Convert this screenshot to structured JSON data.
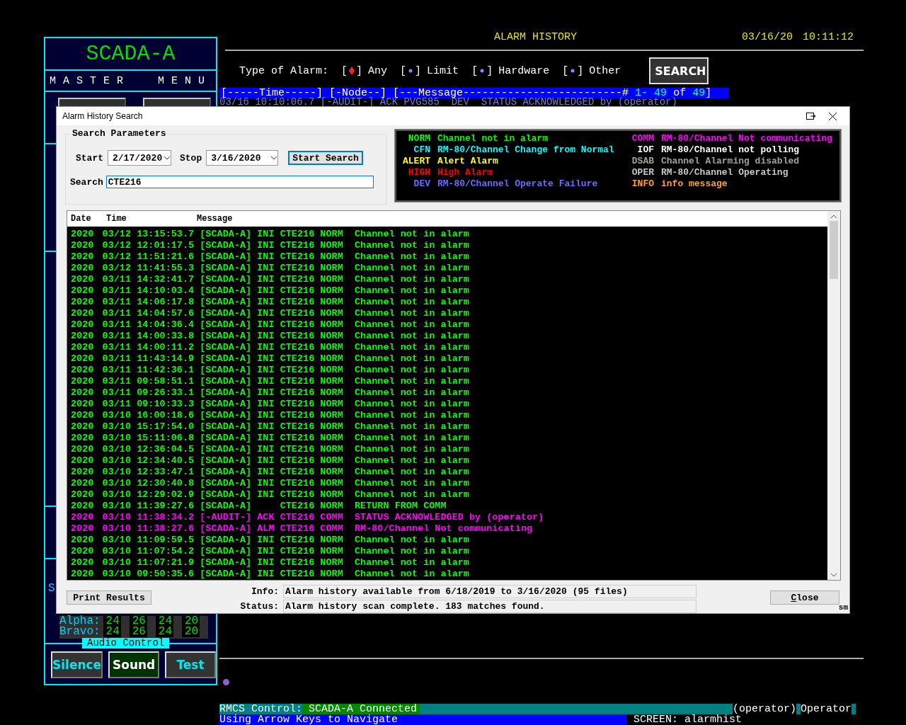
{
  "left_panel": {
    "title": "SCADA-A",
    "subtitle": "MASTER MENU",
    "partial_label": "S",
    "counts": [
      {
        "label": "Alpha:",
        "values": [
          "24",
          "26",
          "24",
          "20"
        ]
      },
      {
        "label": "Bravo:",
        "values": [
          "24",
          "26",
          "24",
          "20"
        ]
      }
    ],
    "audio": {
      "title": "Audio Control",
      "buttons": [
        {
          "label": "Silence",
          "selected": false
        },
        {
          "label": "Sound",
          "selected": true
        },
        {
          "label": "Test",
          "selected": false
        }
      ]
    }
  },
  "header": {
    "title": "ALARM HISTORY",
    "date": "03/16/20",
    "time": "10:11:12"
  },
  "filter": {
    "label": "Type of Alarm:",
    "options": [
      {
        "open": "[",
        "close": "]",
        "label": "Any",
        "selected": true
      },
      {
        "open": "[",
        "close": "]",
        "label": "Limit",
        "selected": false
      },
      {
        "open": "[",
        "close": "]",
        "label": "Hardware",
        "selected": false
      },
      {
        "open": "[",
        "close": "]",
        "label": "Other",
        "selected": false
      }
    ],
    "button": "SEARCH"
  },
  "column_header": {
    "label": "[-----Time-----] [-Node--] [---Message-------------------------#",
    "first": " 1- 49",
    "of": "of",
    "last": " 49",
    "close": "]"
  },
  "partial_row": "03/16 10:10:06.7 [-AUDIT-] ACK PVG585  DEV  STATUS ACKNOWLEDGED by (operator)",
  "status_bar": {
    "control_label": "RMCS Control:",
    "connection": "SCADA-A Connected",
    "user": "(operator)",
    "role": "Operator",
    "hint": "Using Arrow Keys to Navigate",
    "screen": "SCREEN: alarmhist"
  },
  "dialog": {
    "title": "Alarm History Search",
    "params": {
      "title": "Search Parameters",
      "start_label": "Start",
      "start": "2/17/2020",
      "stop_label": "Stop",
      "stop": "3/16/2020",
      "button": "Start Search",
      "search_label": "Search",
      "search": "CTE216"
    },
    "legend": [
      {
        "code": "NORM",
        "text": "Channel not in alarm",
        "color": "#00ff00"
      },
      {
        "code": "CFN",
        "text": "RM-80/Channel Change from Normal",
        "color": "#00ffff"
      },
      {
        "code": "ALERT",
        "text": "Alert Alarm",
        "color": "#ffff00"
      },
      {
        "code": "HIGH",
        "text": "High Alarm",
        "color": "#ff0000"
      },
      {
        "code": "DEV",
        "text": "RM-80/Channel Operate Failure",
        "color": "#6b6bff"
      },
      {
        "code": "COMM",
        "text": "RM-80/Channel Not communicating",
        "color": "#ff00ff"
      },
      {
        "code": "IOF",
        "text": "RM-80/Channel not polling",
        "color": "#ffffff"
      },
      {
        "code": "DSAB",
        "text": "Channel Alarming disabled",
        "color": "#a0a0a0"
      },
      {
        "code": "OPER",
        "text": "RM-80/Channel Operating",
        "color": "#c8c8c8"
      },
      {
        "code": "INFO",
        "text": "info message",
        "color": "#ffa030"
      }
    ],
    "columns": [
      "Date",
      "Time",
      "Message"
    ],
    "rows": [
      {
        "year": "2020",
        "date": "03/12",
        "time": "13:15:53.7",
        "node": "[SCADA-A]",
        "code": "INI",
        "point": "CTE216",
        "state": "NORM",
        "message": "Channel not in alarm",
        "color": "#00ff00"
      },
      {
        "year": "2020",
        "date": "03/12",
        "time": "12:01:17.5",
        "node": "[SCADA-A]",
        "code": "INI",
        "point": "CTE216",
        "state": "NORM",
        "message": "Channel not in alarm",
        "color": "#00ff00"
      },
      {
        "year": "2020",
        "date": "03/12",
        "time": "11:51:21.6",
        "node": "[SCADA-A]",
        "code": "INI",
        "point": "CTE216",
        "state": "NORM",
        "message": "Channel not in alarm",
        "color": "#00ff00"
      },
      {
        "year": "2020",
        "date": "03/12",
        "time": "11:41:55.3",
        "node": "[SCADA-A]",
        "code": "INI",
        "point": "CTE216",
        "state": "NORM",
        "message": "Channel not in alarm",
        "color": "#00ff00"
      },
      {
        "year": "2020",
        "date": "03/11",
        "time": "14:32:41.7",
        "node": "[SCADA-A]",
        "code": "INI",
        "point": "CTE216",
        "state": "NORM",
        "message": "Channel not in alarm",
        "color": "#00ff00"
      },
      {
        "year": "2020",
        "date": "03/11",
        "time": "14:10:03.4",
        "node": "[SCADA-A]",
        "code": "INI",
        "point": "CTE216",
        "state": "NORM",
        "message": "Channel not in alarm",
        "color": "#00ff00"
      },
      {
        "year": "2020",
        "date": "03/11",
        "time": "14:06:17.8",
        "node": "[SCADA-A]",
        "code": "INI",
        "point": "CTE216",
        "state": "NORM",
        "message": "Channel not in alarm",
        "color": "#00ff00"
      },
      {
        "year": "2020",
        "date": "03/11",
        "time": "14:04:57.6",
        "node": "[SCADA-A]",
        "code": "INI",
        "point": "CTE216",
        "state": "NORM",
        "message": "Channel not in alarm",
        "color": "#00ff00"
      },
      {
        "year": "2020",
        "date": "03/11",
        "time": "14:04:36.4",
        "node": "[SCADA-A]",
        "code": "INI",
        "point": "CTE216",
        "state": "NORM",
        "message": "Channel not in alarm",
        "color": "#00ff00"
      },
      {
        "year": "2020",
        "date": "03/11",
        "time": "14:00:33.8",
        "node": "[SCADA-A]",
        "code": "INI",
        "point": "CTE216",
        "state": "NORM",
        "message": "Channel not in alarm",
        "color": "#00ff00"
      },
      {
        "year": "2020",
        "date": "03/11",
        "time": "14:00:11.2",
        "node": "[SCADA-A]",
        "code": "INI",
        "point": "CTE216",
        "state": "NORM",
        "message": "Channel not in alarm",
        "color": "#00ff00"
      },
      {
        "year": "2020",
        "date": "03/11",
        "time": "11:43:14.9",
        "node": "[SCADA-A]",
        "code": "INI",
        "point": "CTE216",
        "state": "NORM",
        "message": "Channel not in alarm",
        "color": "#00ff00"
      },
      {
        "year": "2020",
        "date": "03/11",
        "time": "11:42:36.1",
        "node": "[SCADA-A]",
        "code": "INI",
        "point": "CTE216",
        "state": "NORM",
        "message": "Channel not in alarm",
        "color": "#00ff00"
      },
      {
        "year": "2020",
        "date": "03/11",
        "time": "09:58:51.1",
        "node": "[SCADA-A]",
        "code": "INI",
        "point": "CTE216",
        "state": "NORM",
        "message": "Channel not in alarm",
        "color": "#00ff00"
      },
      {
        "year": "2020",
        "date": "03/11",
        "time": "09:26:33.1",
        "node": "[SCADA-A]",
        "code": "INI",
        "point": "CTE216",
        "state": "NORM",
        "message": "Channel not in alarm",
        "color": "#00ff00"
      },
      {
        "year": "2020",
        "date": "03/11",
        "time": "09:10:33.3",
        "node": "[SCADA-A]",
        "code": "INI",
        "point": "CTE216",
        "state": "NORM",
        "message": "Channel not in alarm",
        "color": "#00ff00"
      },
      {
        "year": "2020",
        "date": "03/10",
        "time": "16:00:18.6",
        "node": "[SCADA-A]",
        "code": "INI",
        "point": "CTE216",
        "state": "NORM",
        "message": "Channel not in alarm",
        "color": "#00ff00"
      },
      {
        "year": "2020",
        "date": "03/10",
        "time": "15:17:54.0",
        "node": "[SCADA-A]",
        "code": "INI",
        "point": "CTE216",
        "state": "NORM",
        "message": "Channel not in alarm",
        "color": "#00ff00"
      },
      {
        "year": "2020",
        "date": "03/10",
        "time": "15:11:06.8",
        "node": "[SCADA-A]",
        "code": "INI",
        "point": "CTE216",
        "state": "NORM",
        "message": "Channel not in alarm",
        "color": "#00ff00"
      },
      {
        "year": "2020",
        "date": "03/10",
        "time": "12:36:04.5",
        "node": "[SCADA-A]",
        "code": "INI",
        "point": "CTE216",
        "state": "NORM",
        "message": "Channel not in alarm",
        "color": "#00ff00"
      },
      {
        "year": "2020",
        "date": "03/10",
        "time": "12:34:40.5",
        "node": "[SCADA-A]",
        "code": "INI",
        "point": "CTE216",
        "state": "NORM",
        "message": "Channel not in alarm",
        "color": "#00ff00"
      },
      {
        "year": "2020",
        "date": "03/10",
        "time": "12:33:47.1",
        "node": "[SCADA-A]",
        "code": "INI",
        "point": "CTE216",
        "state": "NORM",
        "message": "Channel not in alarm",
        "color": "#00ff00"
      },
      {
        "year": "2020",
        "date": "03/10",
        "time": "12:30:40.8",
        "node": "[SCADA-A]",
        "code": "INI",
        "point": "CTE216",
        "state": "NORM",
        "message": "Channel not in alarm",
        "color": "#00ff00"
      },
      {
        "year": "2020",
        "date": "03/10",
        "time": "12:29:02.9",
        "node": "[SCADA-A]",
        "code": "INI",
        "point": "CTE216",
        "state": "NORM",
        "message": "Channel not in alarm",
        "color": "#00ff00"
      },
      {
        "year": "2020",
        "date": "03/10",
        "time": "11:39:27.6",
        "node": "[SCADA-A]",
        "point": "CTE216",
        "state": "NORM",
        "message": "RETURN FROM COMM",
        "color": "#00ff00"
      },
      {
        "year": "2020",
        "date": "03/10",
        "time": "11:38:34.2",
        "node": "[-AUDIT-]",
        "code": "ACK",
        "point": "CTE216",
        "state": "COMM",
        "message": "STATUS ACKNOWLEDGED by (operator)",
        "color": "#ff00ff"
      },
      {
        "year": "2020",
        "date": "03/10",
        "time": "11:38:27.6",
        "node": "[SCADA-A]",
        "code": "ALM",
        "point": "CTE216",
        "state": "COMM",
        "message": "RM-80/Channel Not communicating",
        "color": "#ff00ff"
      },
      {
        "year": "2020",
        "date": "03/10",
        "time": "11:09:59.5",
        "node": "[SCADA-A]",
        "code": "INI",
        "point": "CTE216",
        "state": "NORM",
        "message": "Channel not in alarm",
        "color": "#00ff00"
      },
      {
        "year": "2020",
        "date": "03/10",
        "time": "11:07:54.2",
        "node": "[SCADA-A]",
        "code": "INI",
        "point": "CTE216",
        "state": "NORM",
        "message": "Channel not in alarm",
        "color": "#00ff00"
      },
      {
        "year": "2020",
        "date": "03/10",
        "time": "11:07:21.9",
        "node": "[SCADA-A]",
        "code": "INI",
        "point": "CTE216",
        "state": "NORM",
        "message": "Channel not in alarm",
        "color": "#00ff00"
      },
      {
        "year": "2020",
        "date": "03/10",
        "time": "09:50:35.6",
        "node": "[SCADA-A]",
        "code": "INI",
        "point": "CTE216",
        "state": "NORM",
        "message": "Channel not in alarm",
        "color": "#00ff00"
      }
    ],
    "footer": {
      "print": "Print Results",
      "info_label": "Info:",
      "info": "Alarm history available from 6/18/2019 to 3/16/2020 (95 files)",
      "status_label": "Status:",
      "status": "Alarm history scan complete.  183 matches found.",
      "close": "Close",
      "corner": "sm"
    }
  }
}
